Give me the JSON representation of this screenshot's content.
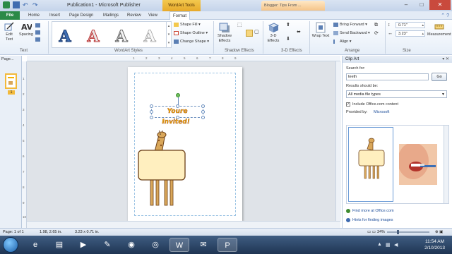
{
  "window": {
    "title": "Publication1 - Microsoft Publisher",
    "context_tab_header": "WordArt Tools",
    "browser_tab": "Blogger: Tips From ..."
  },
  "tabs": [
    {
      "label": "File"
    },
    {
      "label": "Home"
    },
    {
      "label": "Insert"
    },
    {
      "label": "Page Design"
    },
    {
      "label": "Mailings"
    },
    {
      "label": "Review"
    },
    {
      "label": "View"
    },
    {
      "label": "Format"
    }
  ],
  "ribbon": {
    "text_group": {
      "label": "Text",
      "edit_text": "Edit Text",
      "spacing": "Spacing"
    },
    "wordart_styles": {
      "label": "WordArt Styles",
      "shape_fill": "Shape Fill",
      "shape_outline": "Shape Outline",
      "change_shape": "Change Shape"
    },
    "shadow_effects": {
      "label": "Shadow Effects",
      "shadow_effects_btn": "Shadow Effects"
    },
    "three_d_effects": {
      "label": "3-D Effects",
      "three_d_btn": "3-D Effects"
    },
    "arrange": {
      "label": "Arrange",
      "wrap_text": "Wrap Text",
      "bring_forward": "Bring Forward",
      "send_backward": "Send Backward",
      "align": "Align"
    },
    "size": {
      "label": "Size",
      "height": "0.71\"",
      "width": "3.23\"",
      "measurement": "Measurement"
    }
  },
  "pages_panel": {
    "header": "Page...",
    "page_number": "1"
  },
  "canvas": {
    "wordart_text": "Youre Invited!",
    "ruler_top": [
      "1",
      "2",
      "3",
      "4",
      "5",
      "6",
      "7",
      "8",
      "9"
    ],
    "ruler_left": [
      "1",
      "2",
      "3",
      "4",
      "5",
      "6",
      "7",
      "8",
      "9",
      "10"
    ]
  },
  "clip_art": {
    "title": "Clip Art",
    "search_for_label": "Search for:",
    "search_value": "teeth",
    "go_label": "Go",
    "results_label": "Results should be:",
    "results_value": "All media file types",
    "include_office": "Include Office.com content",
    "provided_by_label": "Provided by:",
    "provided_by_value": "Microsoft",
    "find_more": "Find more at Office.com",
    "hints": "Hints for finding images"
  },
  "status_bar": {
    "page": "Page: 1 of 1",
    "position": "1.98, 2.65 in.",
    "size": "3.23 x 0.71 in.",
    "zoom": "34%"
  },
  "taskbar": {
    "time": "11:54 AM",
    "date": "2/10/2013"
  }
}
